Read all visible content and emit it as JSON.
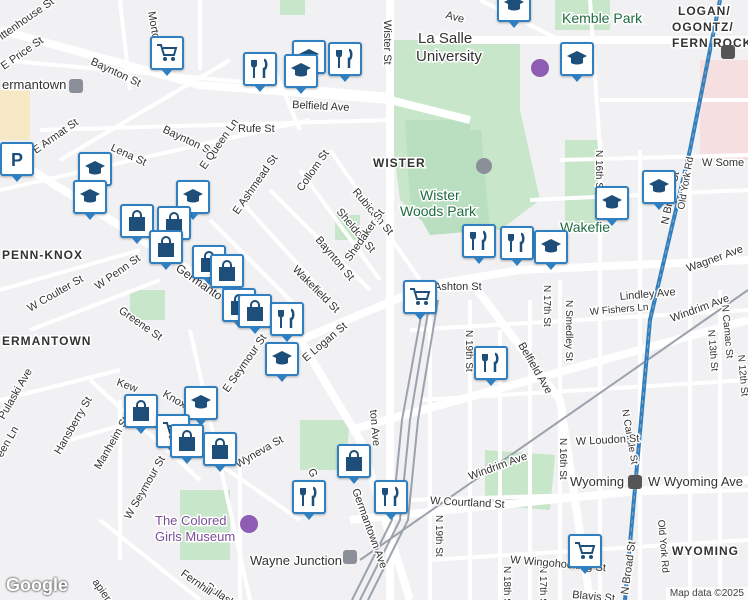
{
  "map": {
    "neighborhoods": {
      "wister": "WISTER",
      "penn_knox": "PENN-KNOX",
      "germantown_top": "ermantown",
      "germantown_mid": "ERMANTOWN",
      "logan_ogontz": "LOGAN/",
      "ogontz": "OGONTZ/",
      "fern_rock": "FERN ROCK",
      "wyoming": "WYOMING"
    },
    "pois": {
      "la_salle_1": "La Salle",
      "la_salle_2": "University",
      "wister_woods_1": "Wister",
      "wister_woods_2": "Woods Park",
      "kemble_park": "Kemble Park",
      "colored_girls_1": "The Colored",
      "colored_girls_2": "Girls Museum",
      "wayne_junction": "Wayne Junction",
      "wakefield": "Wakefie"
    },
    "streets": {
      "bayton_st_1": "Baynton St",
      "belfield_ave_1": "Belfield Ave",
      "rufe_st": "Rufe St",
      "bayton_st_2": "Baynton St",
      "lena_st": "Lena St",
      "e_armat_st": "E Armat St",
      "e_price_st": "E Price St",
      "ittenhouse_st": "ittenhouse St",
      "morton_st": "Morton St",
      "wister_st": "Wister St",
      "e_queen_ln": "E Queen Ln",
      "e_ashmead_st": "E Ashmead St",
      "collom_st": "Collom St",
      "rubicam_st": "Rubicam St",
      "sheldon_st": "Sheldon St",
      "baynton_st_3": "Baynton St",
      "shedaker_st": "Shedaker St",
      "wakefield_st": "Wakefield St",
      "e_logan_st": "E Logan St",
      "w_penn_st": "W Penn St",
      "w_coulter_st": "W Coulter St",
      "greene_st": "Greene St",
      "germantown": "Germanto",
      "e_seymour_st": "E Seymour St",
      "knox": "Knox",
      "kew": "Kew",
      "pulaski_ave": "Pulaski Ave",
      "hansberry_st": "Hansberry St",
      "manheim_st": "Manheim St",
      "een_ln": "een Ln",
      "w_seymour_st": "W Seymour St",
      "wyneva_st": "Wyneva St",
      "germantown_ave": "Germantown Ave",
      "ton_ave": "ton Ave",
      "pulaski_ave_2": "Pulaski Ave",
      "fernhill": "Fernhill",
      "apier_st": "apier St",
      "ashton_st": "Ashton St",
      "lindley_ave": "Lindley Ave",
      "w_fishers_ln": "W Fishers Ln",
      "wagner_ave": "Wagner Ave",
      "windrim_ave": "Windrim Ave",
      "windrim_ave_2": "Windrim Ave",
      "belfield_ave_2": "Belfield Ave",
      "n_19th_st": "N 19th St",
      "n_19th_st_2": "N 19th St",
      "n_18th_st": "N 18th St",
      "n_17th_st": "N 17th St",
      "n_17th_st_2": "N 17th St",
      "n_16th_st": "N 16th St",
      "n_16th_st_2": "N 16th St",
      "n_smedley_st": "N Smedley St",
      "n_broad_st": "N Broad St",
      "n_broad_st_2": "N Broad St",
      "old_york_rd": "Old York Rd",
      "old_york_rd_2": "Old York Rd",
      "n_13th_st": "N 13th St",
      "n_12th_st": "N 12th St",
      "n_camac_st": "N Camac St",
      "n_carlisle_st": "N Carlisle St",
      "w_loudon_st": "W Loudon St",
      "w_courtland_st": "W Courtland St",
      "wyoming": "Wyoming",
      "w_wyoming_ave": "W Wyoming Ave",
      "w_wingohocking": "W Wingohocking St",
      "blavis_st": "Blavis St",
      "w_some": "W Some",
      "ave_top": "Ave",
      "g_st": "G"
    },
    "colors": {
      "park": "#c8e6c9",
      "road": "#ffffff",
      "arterial": "#fce9a6",
      "rail": "#9aa3ad",
      "transit_line": "#2f7fc1",
      "marker_border": "#2f7fc1",
      "marker_icon": "#1d4f7a"
    },
    "icons": [
      "shopping-cart-icon",
      "fork-knife-icon",
      "graduation-cap-icon",
      "shopping-bag-icon",
      "museum-icon",
      "train-station-icon",
      "subway-icon"
    ]
  },
  "attribution": "Map data ©2025",
  "logo": "Google"
}
